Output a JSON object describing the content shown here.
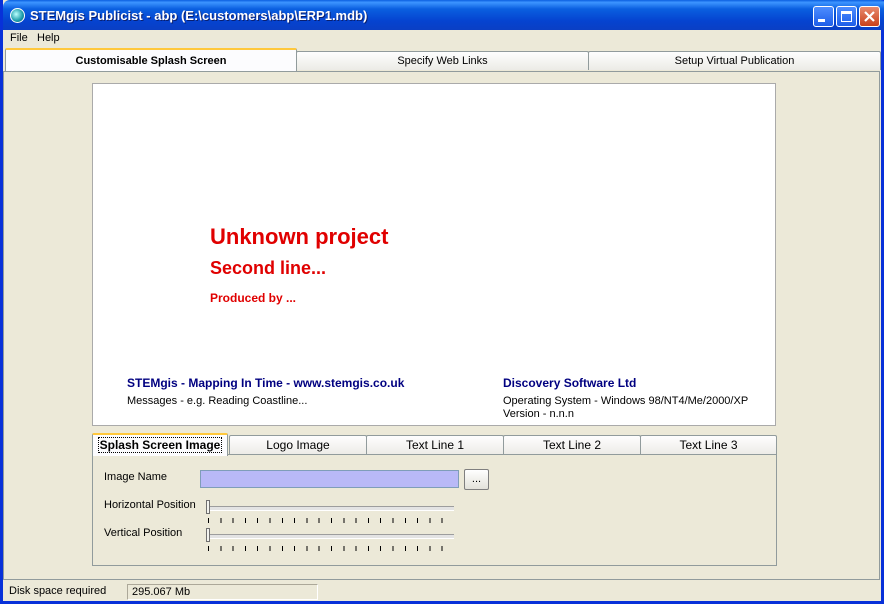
{
  "window": {
    "title": "STEMgis Publicist - abp (E:\\customers\\abp\\ERP1.mdb)",
    "controls": [
      "minimize-icon",
      "maximize-icon",
      "close-icon"
    ]
  },
  "menu": [
    "File",
    "Help"
  ],
  "main_tabs": [
    {
      "label": "Customisable Splash Screen",
      "active": true
    },
    {
      "label": "Specify Web Links",
      "active": false
    },
    {
      "label": "Setup Virtual Publication",
      "active": false
    }
  ],
  "splash": {
    "project_title": "Unknown project",
    "second_line": "Second line...",
    "produced_by": "Produced by ...",
    "left_heading": "STEMgis - Mapping In Time - www.stemgis.co.uk",
    "left_message": "Messages - e.g. Reading Coastline...",
    "right_heading": "Discovery Software Ltd",
    "right_os": "Operating System - Windows 98/NT4/Me/2000/XP",
    "right_version": "Version - n.n.n"
  },
  "sub_tabs": [
    {
      "label": "Splash Screen Image",
      "active": true
    },
    {
      "label": "Logo Image",
      "active": false
    },
    {
      "label": "Text Line 1",
      "active": false
    },
    {
      "label": "Text Line 2",
      "active": false
    },
    {
      "label": "Text Line 3",
      "active": false
    }
  ],
  "image_settings": {
    "image_name_label": "Image Name",
    "image_name_value": "",
    "browse_label": "...",
    "horizontal_label": "Horizontal Position",
    "horizontal_value": 0,
    "vertical_label": "Vertical Position",
    "vertical_value": 0
  },
  "status": {
    "label": "Disk space required",
    "value": "295.067 Mb"
  },
  "colors": {
    "accent_red": "#e00000",
    "heading_blue": "#000080",
    "input_fill": "#b9b9f7"
  }
}
